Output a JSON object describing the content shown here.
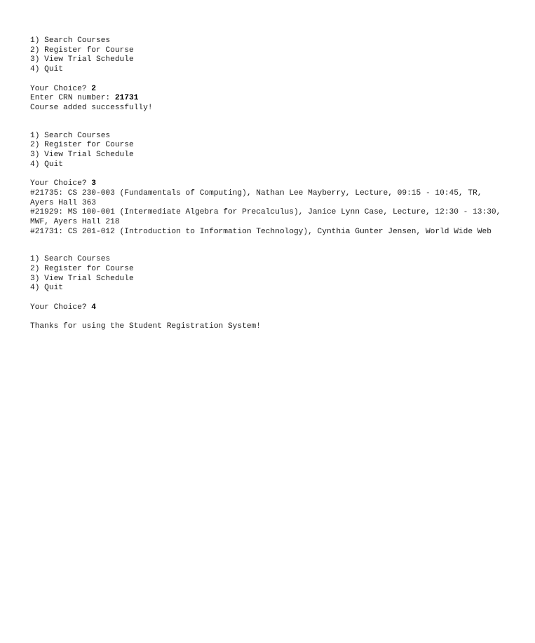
{
  "menu": {
    "items": [
      "1) Search Courses",
      "2) Register for Course",
      "3) View Trial Schedule",
      "4) Quit"
    ]
  },
  "session": [
    {
      "prompt": "Your Choice? ",
      "choice": "2",
      "crn_prompt": "Enter CRN number: ",
      "crn_value": "21731",
      "result": "Course added successfully!"
    },
    {
      "prompt": "Your Choice? ",
      "choice": "3",
      "schedule": [
        "#21735: CS 230-003 (Fundamentals of Computing), Nathan Lee Mayberry, Lecture, 09:15 - 10:45, TR, Ayers Hall 363",
        "#21929: MS 100-001 (Intermediate Algebra for Precalculus), Janice Lynn Case, Lecture, 12:30 - 13:30, MWF, Ayers Hall 218",
        "#21731: CS 201-012 (Introduction to Information Technology), Cynthia Gunter Jensen, World Wide Web"
      ]
    },
    {
      "prompt": "Your Choice? ",
      "choice": "4",
      "result": "Thanks for using the Student Registration System!"
    }
  ]
}
